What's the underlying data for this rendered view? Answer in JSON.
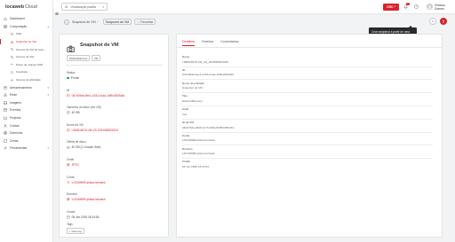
{
  "brand": {
    "name": "locaweb",
    "product": "Cloud"
  },
  "sidebar": {
    "items": [
      {
        "label": "Dashboard",
        "icon": "home-icon",
        "sub": false
      },
      {
        "label": "Computação",
        "icon": "server-icon",
        "sub": false,
        "expanded": true
      },
      {
        "label": "VMs",
        "icon": "monitor-icon",
        "sub": true
      },
      {
        "label": "Snapshot de VM",
        "icon": "camera-icon",
        "sub": true,
        "active": true
      },
      {
        "label": "Grupos de VM de auto...",
        "icon": "group-icon",
        "sub": true
      },
      {
        "label": "Grupos de VM",
        "icon": "group-icon",
        "sub": true
      },
      {
        "label": "Pares de chaves SSH",
        "icon": "key-icon",
        "sub": true
      },
      {
        "label": "Userdata",
        "icon": "file-icon",
        "sub": true
      },
      {
        "label": "Grupos de afinidade",
        "icon": "link-icon",
        "sub": true
      },
      {
        "label": "Armazenamento",
        "icon": "database-icon",
        "sub": false
      },
      {
        "label": "Rede",
        "icon": "network-icon",
        "sub": false
      },
      {
        "label": "Imagens",
        "icon": "image-icon",
        "sub": false
      },
      {
        "label": "Eventos",
        "icon": "calendar-icon",
        "sub": false
      },
      {
        "label": "Projetos",
        "icon": "folder-icon",
        "sub": false
      },
      {
        "label": "Contas",
        "icon": "user-icon",
        "sub": false
      },
      {
        "label": "Domínios",
        "icon": "globe-icon",
        "sub": false
      },
      {
        "label": "Zonas",
        "icon": "map-icon",
        "sub": false
      },
      {
        "label": "Ferramentas",
        "icon": "tool-icon",
        "sub": false
      }
    ]
  },
  "topbar": {
    "search_value": "Visualização padrão",
    "crc_label": "CRC",
    "notif_count": "0",
    "user_name": "Vinícius Gomes"
  },
  "breadcrumb": {
    "parent": "Snapshot de VM",
    "current": "Snapshot de VM",
    "favorite_label": "Favoritar"
  },
  "tooltip": {
    "text": "Criar snapshot a partir de uma snapshot de VM"
  },
  "resource": {
    "title": "Snapshot de VM",
    "tags": [
      "DiskAndMemory",
      "VM"
    ],
    "fields": [
      {
        "label": "Status",
        "value": "Pronto",
        "kind": "status"
      },
      {
        "label": "ID",
        "value": "0d7c09da-9ee1-4154-b1aa-1bf9c2829d4d",
        "kind": "link",
        "icon": "id-icon"
      },
      {
        "label": "Tamanho do disco (em GB)",
        "value": "40 GB",
        "kind": "text",
        "icon": "disk-icon"
      },
      {
        "label": "Nome da VM",
        "value": "i-9808-8576-VM-VS-2020080524324",
        "kind": "link",
        "icon": "monitor-icon"
      },
      {
        "label": "Oferta de disco",
        "value": "40 GB (1 Custom Size)",
        "kind": "text",
        "icon": "disk-icon"
      },
      {
        "label": "Zonal",
        "value": "ZPO1",
        "kind": "link",
        "icon": "globe-icon"
      },
      {
        "label": "Conta",
        "value": "LOCAWEB-Iplaca-locstack",
        "kind": "link",
        "icon": "user-icon"
      },
      {
        "label": "Domínio",
        "value": "LOCAWEB-Iplaca-locstack",
        "kind": "link",
        "icon": "globe-icon"
      },
      {
        "label": "Criado",
        "value": "05 Jun 2020 18:14:54",
        "kind": "text",
        "icon": "calendar-icon"
      }
    ],
    "tags_label": "Tags",
    "add_tag_label": "+ New tag"
  },
  "detail_tabs": [
    "Detalhes",
    "Eventos",
    "Comentários"
  ],
  "details": [
    {
      "label": "Nome",
      "value": "i-9808-8576-VM_VS_2020080524324"
    },
    {
      "label": "ID",
      "value": "0d7c09da-9ee1-4154-b1aa-1bf9c2829d4d"
    },
    {
      "label": "Nome de exibição",
      "value": "Snapshot de VM"
    },
    {
      "label": "Tipo",
      "value": "DiskAndMemory"
    },
    {
      "label": "Atual",
      "value": "true"
    },
    {
      "label": "ID da VM",
      "value": "06e673da-a848-4c73-9d6a-0f46b0d5b014"
    },
    {
      "label": "Conta",
      "value": "LOCAWEB-Iplaca-locstack"
    },
    {
      "label": "Domínio",
      "value": "LOCAWEB-Iplaca-locstack"
    },
    {
      "label": "Criado",
      "value": "05 Jun 2020 18:14:54"
    }
  ],
  "colors": {
    "accent": "#d8232a",
    "status_ok": "#1e9e4a"
  }
}
